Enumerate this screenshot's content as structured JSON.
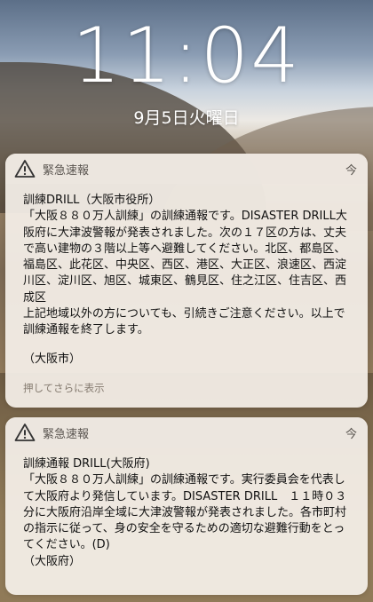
{
  "lockscreen": {
    "time": "11:04",
    "date": "9月5日火曜日"
  },
  "notifications": [
    {
      "app": "緊急速報",
      "time": "今",
      "icon": "warning-triangle-icon",
      "title": "訓練DRILL（大阪市役所）",
      "body": "「大阪８８０万人訓練」の訓練通報です。DISASTER DRILL大阪府に大津波警報が発表されました。次の１７区の方は、丈夫で高い建物の３階以上等へ避難してください。北区、都島区、福島区、此花区、中央区、西区、港区、大正区、浪速区、西淀川区、淀川区、旭区、城東区、鶴見区、住之江区、住吉区、西成区\n上記地域以外の方についても、引続きご注意ください。以上で訓練通報を終了します。",
      "signature": "（大阪市）",
      "more_label": "押してさらに表示"
    },
    {
      "app": "緊急速報",
      "time": "今",
      "icon": "warning-triangle-icon",
      "title": "訓練通報 DRILL(大阪府)",
      "body": "「大阪８８０万人訓練」の訓練通報です。実行委員会を代表して大阪府より発信しています。DISASTER DRILL　１１時０３分に大阪府沿岸全域に大津波警報が発表されました。各市町村の指示に従って、身の安全を守るための適切な避難行動をとってください。(D)\n（大阪府）"
    }
  ]
}
